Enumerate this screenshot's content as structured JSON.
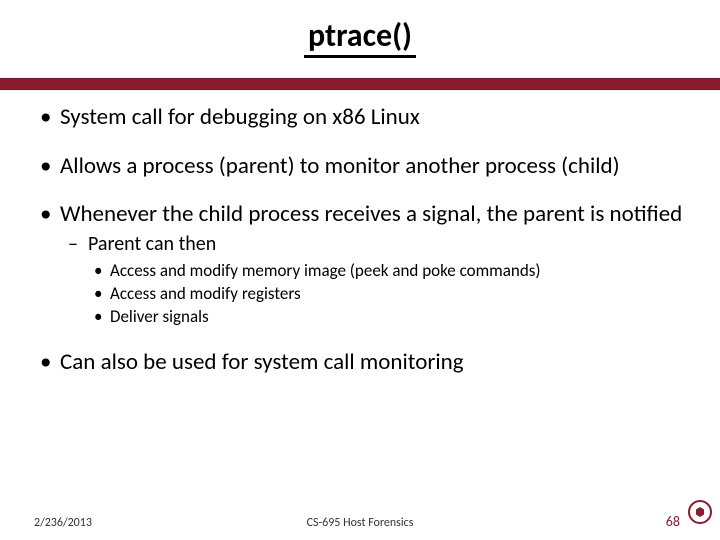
{
  "title": "ptrace()",
  "bullets": {
    "b1_0": "System call for debugging on x86 Linux",
    "b1_1": "Allows a process (parent) to monitor another process (child)",
    "b1_2": "Whenever the child process receives a signal, the parent is notified",
    "b2_0": "Parent can then",
    "b3_0": "Access and modify memory image (peek and poke commands)",
    "b3_1": "Access and modify registers",
    "b3_2": "Deliver signals",
    "b1_3": "Can also be used for system call monitoring"
  },
  "footer": {
    "date": "2/236/2013",
    "course": "CS-695 Host Forensics",
    "page": "68"
  }
}
